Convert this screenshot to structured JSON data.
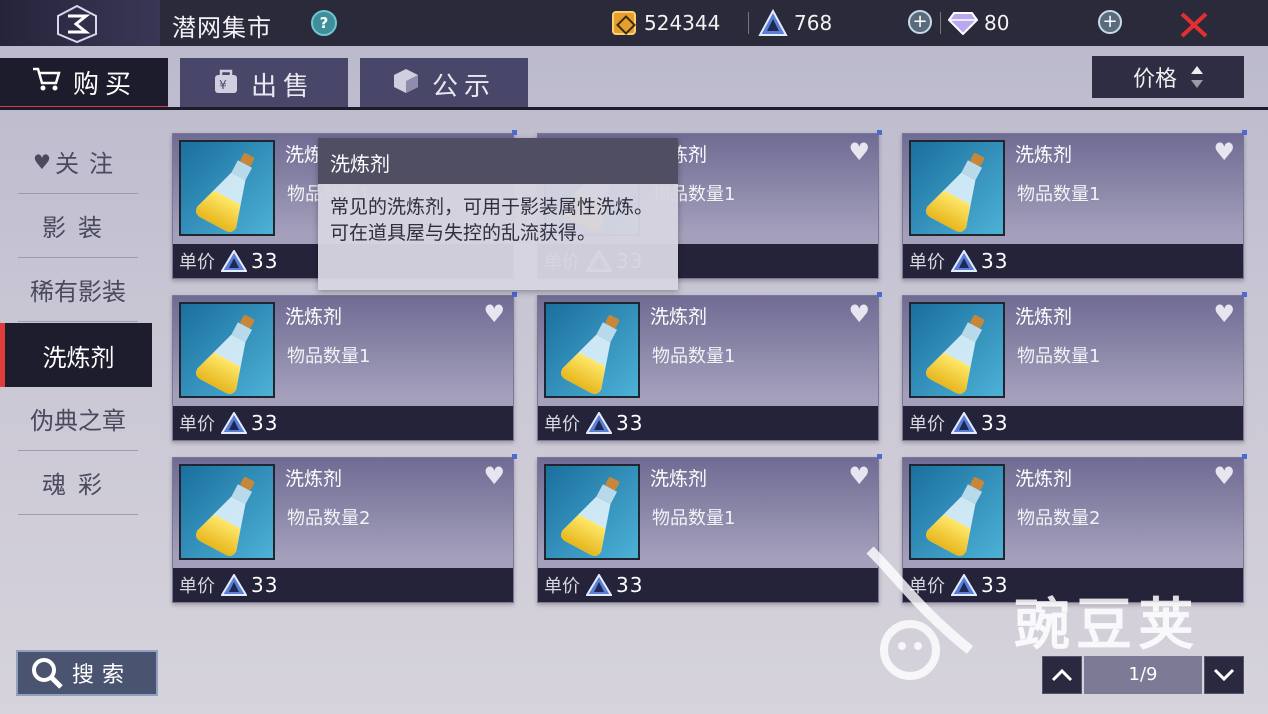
{
  "header": {
    "title": "潜网集市",
    "help_icon": "question-icon",
    "currencies": [
      {
        "icon": "coin-icon",
        "value": "524344"
      },
      {
        "icon": "crystal-triangle-icon",
        "value": "768"
      },
      {
        "icon": "diamond-icon",
        "value": "80"
      }
    ],
    "close_icon": "close-icon"
  },
  "tabs": [
    {
      "label": "购买",
      "icon": "cart-icon",
      "active": true
    },
    {
      "label": "出售",
      "icon": "bag-icon",
      "active": false
    },
    {
      "label": "公示",
      "icon": "cube-icon",
      "active": false
    }
  ],
  "sort": {
    "label": "价格",
    "icon": "sort-arrows-icon"
  },
  "sidebar": {
    "items": [
      {
        "label": "关注",
        "icon": "heart-icon",
        "active": false
      },
      {
        "label": "影装",
        "active": false
      },
      {
        "label": "稀有影装",
        "active": false
      },
      {
        "label": "洗炼剂",
        "active": true
      },
      {
        "label": "伪典之章",
        "active": false
      },
      {
        "label": "魂彩",
        "active": false
      }
    ]
  },
  "price_label": "单价",
  "cards": [
    {
      "name": "洗炼剂",
      "qty": "物品数量1",
      "price": "33"
    },
    {
      "name": "洗炼剂",
      "qty": "物品数量1",
      "price": "33"
    },
    {
      "name": "洗炼剂",
      "qty": "物品数量1",
      "price": "33"
    },
    {
      "name": "洗炼剂",
      "qty": "物品数量1",
      "price": "33"
    },
    {
      "name": "洗炼剂",
      "qty": "物品数量1",
      "price": "33"
    },
    {
      "name": "洗炼剂",
      "qty": "物品数量1",
      "price": "33"
    },
    {
      "name": "洗炼剂",
      "qty": "物品数量2",
      "price": "33"
    },
    {
      "name": "洗炼剂",
      "qty": "物品数量1",
      "price": "33"
    },
    {
      "name": "洗炼剂",
      "qty": "物品数量2",
      "price": "33"
    }
  ],
  "tooltip": {
    "title": "洗炼剂",
    "body": "常见的洗炼剂，可用于影装属性洗炼。可在道具屋与失控的乱流获得。"
  },
  "search": {
    "label": "搜索",
    "icon": "search-icon"
  },
  "pagination": {
    "label": "1/9",
    "prev_icon": "chevron-up-icon",
    "next_icon": "chevron-down-icon"
  },
  "watermark": {
    "text": "豌豆荚"
  },
  "colors": {
    "accent_red": "#e23b3b",
    "dark_panel": "#1e1d2e",
    "card_purple": "#6f6b93"
  }
}
